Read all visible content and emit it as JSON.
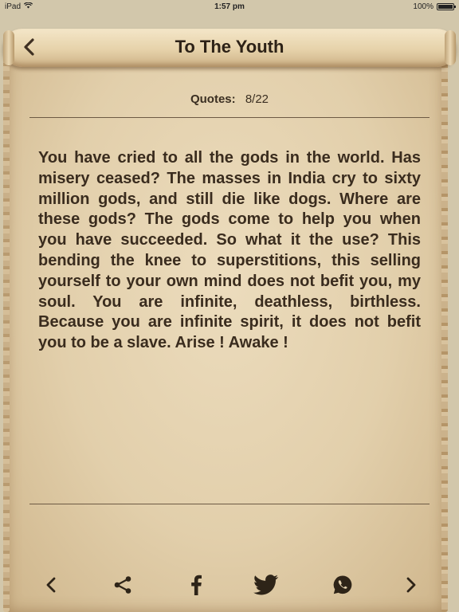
{
  "status_bar": {
    "device": "iPad",
    "time": "1:57 pm",
    "battery": "100%"
  },
  "header": {
    "title": "To The Youth",
    "back_icon": "chevron-left-icon"
  },
  "counter": {
    "label": "Quotes:",
    "value": "8/22"
  },
  "quote": {
    "text": "You have cried to all the gods in the world. Has misery ceased? The masses in India cry to sixty million gods, and still die like dogs. Where are these gods? The gods come to help you when you have succeeded. So what it the use? This bending the knee to superstitions, this selling yourself to your own mind does not befit you, my soul. You are infinite, deathless, birthless. Because you are infinite spirit, it does not befit you to be a slave. Arise ! Awake !"
  },
  "toolbar": {
    "items": [
      "previous-icon",
      "share-icon",
      "facebook-icon",
      "twitter-icon",
      "whatsapp-icon",
      "next-icon"
    ]
  },
  "colors": {
    "text": "#3a2c1e",
    "parchment": "#e2cfab",
    "background": "#d2c7ab"
  }
}
